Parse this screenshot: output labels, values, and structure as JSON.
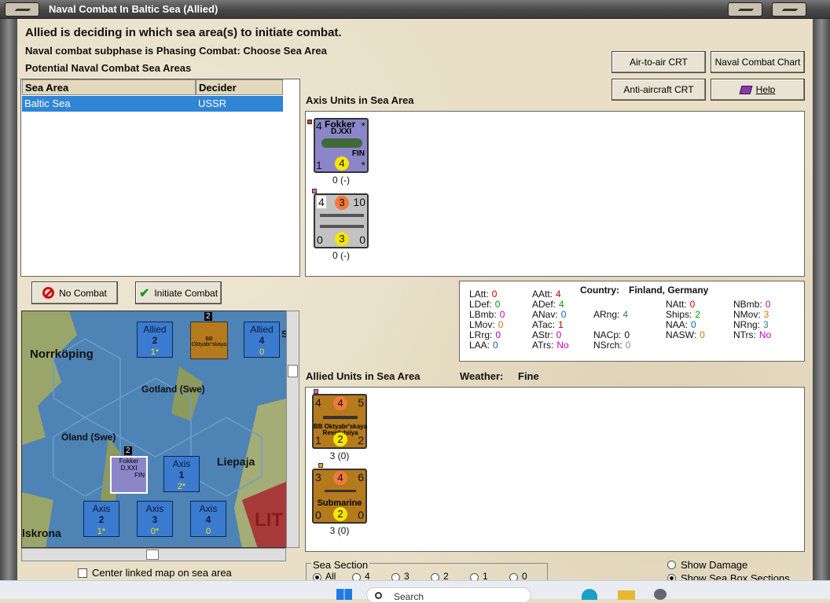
{
  "window": {
    "title": "Naval Combat In Baltic Sea (Allied)"
  },
  "header": {
    "line1": "Allied is deciding in which sea area(s) to initiate combat.",
    "line2": "Naval combat subphase is Phasing Combat: Choose Sea Area",
    "line3": "Potential Naval Combat Sea Areas"
  },
  "buttons": {
    "air_to_air": "Air-to-air CRT",
    "naval_chart": "Naval Combat Chart",
    "anti_aircraft": "Anti-aircraft CRT",
    "help": "Help",
    "no_combat": "No Combat",
    "initiate": "Initiate Combat"
  },
  "sea_table": {
    "headers": [
      "Sea Area",
      "Decider"
    ],
    "rows": [
      [
        "Baltic Sea",
        "USSR"
      ]
    ]
  },
  "axis_section": {
    "title": "Axis Units in Sea Area",
    "units": [
      {
        "name": "Fokker",
        "sub": "D.XXI",
        "nation": "FIN",
        "tl": "4",
        "tr": "*",
        "bl": "1",
        "br": "*",
        "circle": "4",
        "caption": "0 (-)",
        "color": "#8c86c8"
      },
      {
        "tl": "4",
        "tm": "3",
        "tr": "10",
        "bl": "0",
        "bm": "3",
        "br": "0",
        "caption": "0 (-)",
        "color": "#c2c2c2"
      }
    ]
  },
  "stats": {
    "country_label": "Country:",
    "country": "Finland, Germany",
    "items": [
      {
        "k": "LAtt:",
        "v": "0",
        "c": "#c00000"
      },
      {
        "k": "LDef:",
        "v": "0",
        "c": "#00a000"
      },
      {
        "k": "LBmb:",
        "v": "0",
        "c": "#c000c0"
      },
      {
        "k": "LMov:",
        "v": "0",
        "c": "#c08000"
      },
      {
        "k": "LRrg:",
        "v": "0",
        "c": "#c000c0"
      },
      {
        "k": "LAA:",
        "v": "0",
        "c": "#1060c0"
      },
      {
        "k": "AAtt:",
        "v": "4",
        "c": "#c00000"
      },
      {
        "k": "ADef:",
        "v": "4",
        "c": "#00a000"
      },
      {
        "k": "ANav:",
        "v": "0",
        "c": "#1060c0"
      },
      {
        "k": "ARng:",
        "v": "4",
        "c": "#208080"
      },
      {
        "k": "ATac:",
        "v": "1",
        "c": "#c00000"
      },
      {
        "k": "AStr:",
        "v": "0",
        "c": "#c000c0"
      },
      {
        "k": "ATrs:",
        "v": "No",
        "c": "#c000c0"
      },
      {
        "k": "NAtt:",
        "v": "0",
        "c": "#c00000"
      },
      {
        "k": "Ships:",
        "v": "2",
        "c": "#00a000"
      },
      {
        "k": "NAA:",
        "v": "0",
        "c": "#1060c0"
      },
      {
        "k": "NACp:",
        "v": "0",
        "c": "#111111"
      },
      {
        "k": "NASW:",
        "v": "0",
        "c": "#c08000"
      },
      {
        "k": "NSrch:",
        "v": "0",
        "c": "#888888"
      },
      {
        "k": "NBmb:",
        "v": "0",
        "c": "#c000c0"
      },
      {
        "k": "NMov:",
        "v": "3",
        "c": "#c08000"
      },
      {
        "k": "NRng:",
        "v": "3",
        "c": "#208080"
      },
      {
        "k": "NTrs:",
        "v": "No",
        "c": "#c000c0"
      }
    ]
  },
  "allied_section": {
    "title": "Allied Units in Sea Area",
    "weather_label": "Weather:",
    "weather": "Fine",
    "units": [
      {
        "name": "BB Oktyabr'skaya",
        "sub": "Revolutsiya",
        "tl": "4",
        "tm": "4",
        "tr": "5",
        "bl": "1",
        "bm": "2",
        "br": "2",
        "caption": "3 (0)",
        "color": "#b57a1c"
      },
      {
        "name": "Submarine",
        "tl": "3",
        "tm": "4",
        "tr": "6",
        "bl": "0",
        "bm": "2",
        "br": "0",
        "caption": "3 (0)",
        "color": "#b57a1c"
      }
    ]
  },
  "map": {
    "labels": [
      "Norrköping",
      "Gotland (Swe)",
      "Öland (Swe)",
      "Liepaja",
      "lskrona",
      "LIT"
    ],
    "zones": [
      {
        "side": "Allied",
        "num": "2",
        "sub": "1*"
      },
      {
        "side": "Allied",
        "num": "4",
        "sub": "0"
      },
      {
        "side": "Axis",
        "num": "1",
        "sub": "2*"
      },
      {
        "side": "Axis",
        "num": "2",
        "sub": "1*"
      },
      {
        "side": "Axis",
        "num": "3",
        "sub": "0*"
      },
      {
        "side": "Axis",
        "num": "4",
        "sub": "0"
      }
    ],
    "stack_counts": [
      "2",
      "2"
    ],
    "map_unit_mini": {
      "name": "Fokker",
      "sub": "D.XXI",
      "nation": "FIN"
    },
    "map_ship_mini": {
      "name": "BB Oktyabr'skaya"
    },
    "edge_letter": "S"
  },
  "center_link": "Center linked map on sea area",
  "sea_section": {
    "title": "Sea Section",
    "options": [
      "All",
      "4",
      "3",
      "2",
      "1",
      "0"
    ],
    "selected": "All"
  },
  "show_damage": "Show Damage",
  "show_sea_box": "Show Sea Box Sections",
  "taskbar": {
    "search": "Search"
  }
}
